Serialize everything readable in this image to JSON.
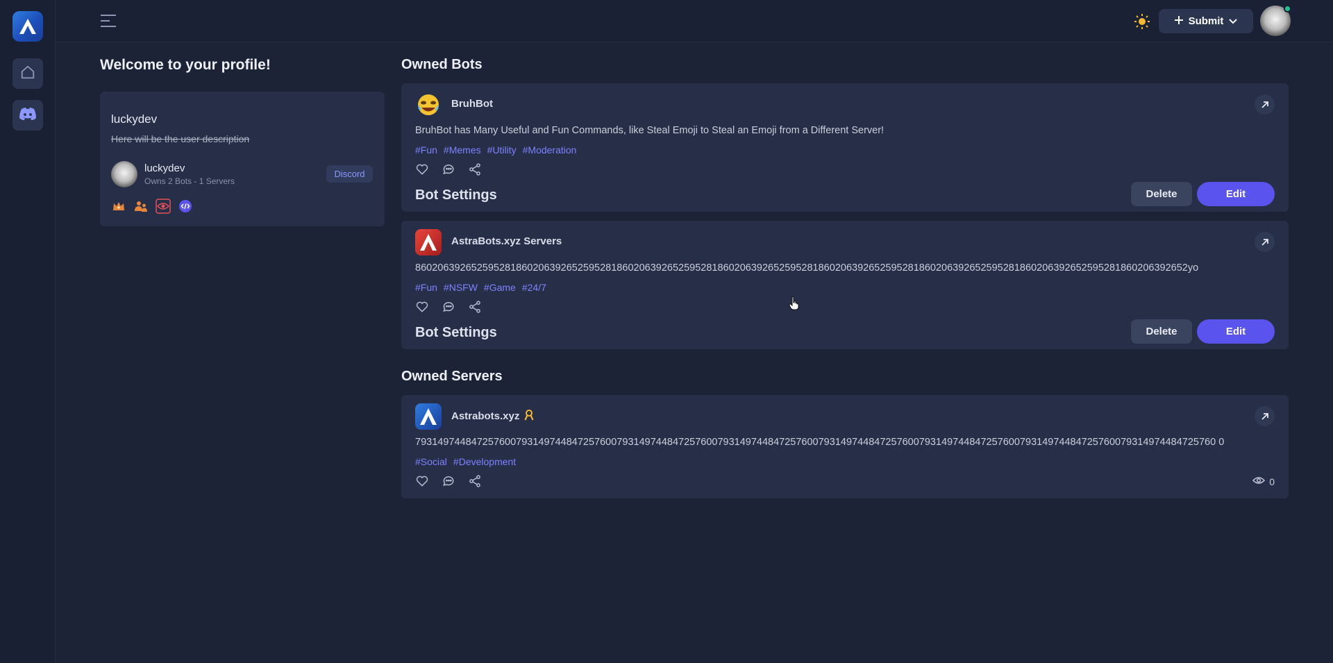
{
  "sidebar": {
    "logo_icon": "astrabots-logo-icon",
    "items": [
      {
        "icon": "home-icon"
      },
      {
        "icon": "discord-icon"
      }
    ]
  },
  "topbar": {
    "menu_icon": "hamburger-icon",
    "theme_icon": "sun-icon",
    "submit_label": "Submit",
    "accent": "#5b53ee"
  },
  "profile": {
    "heading": "Welcome to your profile!",
    "name": "luckydev",
    "description": "Here will be the user description",
    "username": "luckydev",
    "stats": "Owns 2 Bots - 1 Servers",
    "discord_label": "Discord",
    "badges": [
      "crown-icon",
      "users-icon",
      "eye-icon",
      "code-icon"
    ]
  },
  "owned_bots": {
    "heading": "Owned Bots",
    "items": [
      {
        "title": "BruhBot",
        "description": "BruhBot has Many Useful and Fun Commands, like Steal Emoji to Steal an Emoji from a Different Server!",
        "tags": [
          "#Fun",
          "#Memes",
          "#Utility",
          "#Moderation"
        ],
        "settings_label": "Bot Settings",
        "delete_label": "Delete",
        "edit_label": "Edit"
      },
      {
        "title": "AstraBots.xyz Servers",
        "description": "860206392652595281860206392652595281860206392652595281860206392652595281860206392652595281860206392652595281860206392652595281860206392652yo",
        "tags": [
          "#Fun",
          "#NSFW",
          "#Game",
          "#24/7"
        ],
        "settings_label": "Bot Settings",
        "delete_label": "Delete",
        "edit_label": "Edit"
      }
    ]
  },
  "owned_servers": {
    "heading": "Owned Servers",
    "items": [
      {
        "title": "Astrabots.xyz",
        "description": "79314974484725760079314974484725760079314974484725760079314974484725760079314974484725760079314974484725760079314974484725760079314974484725760 0",
        "tags": [
          "#Social",
          "#Development"
        ],
        "views": "0"
      }
    ]
  }
}
